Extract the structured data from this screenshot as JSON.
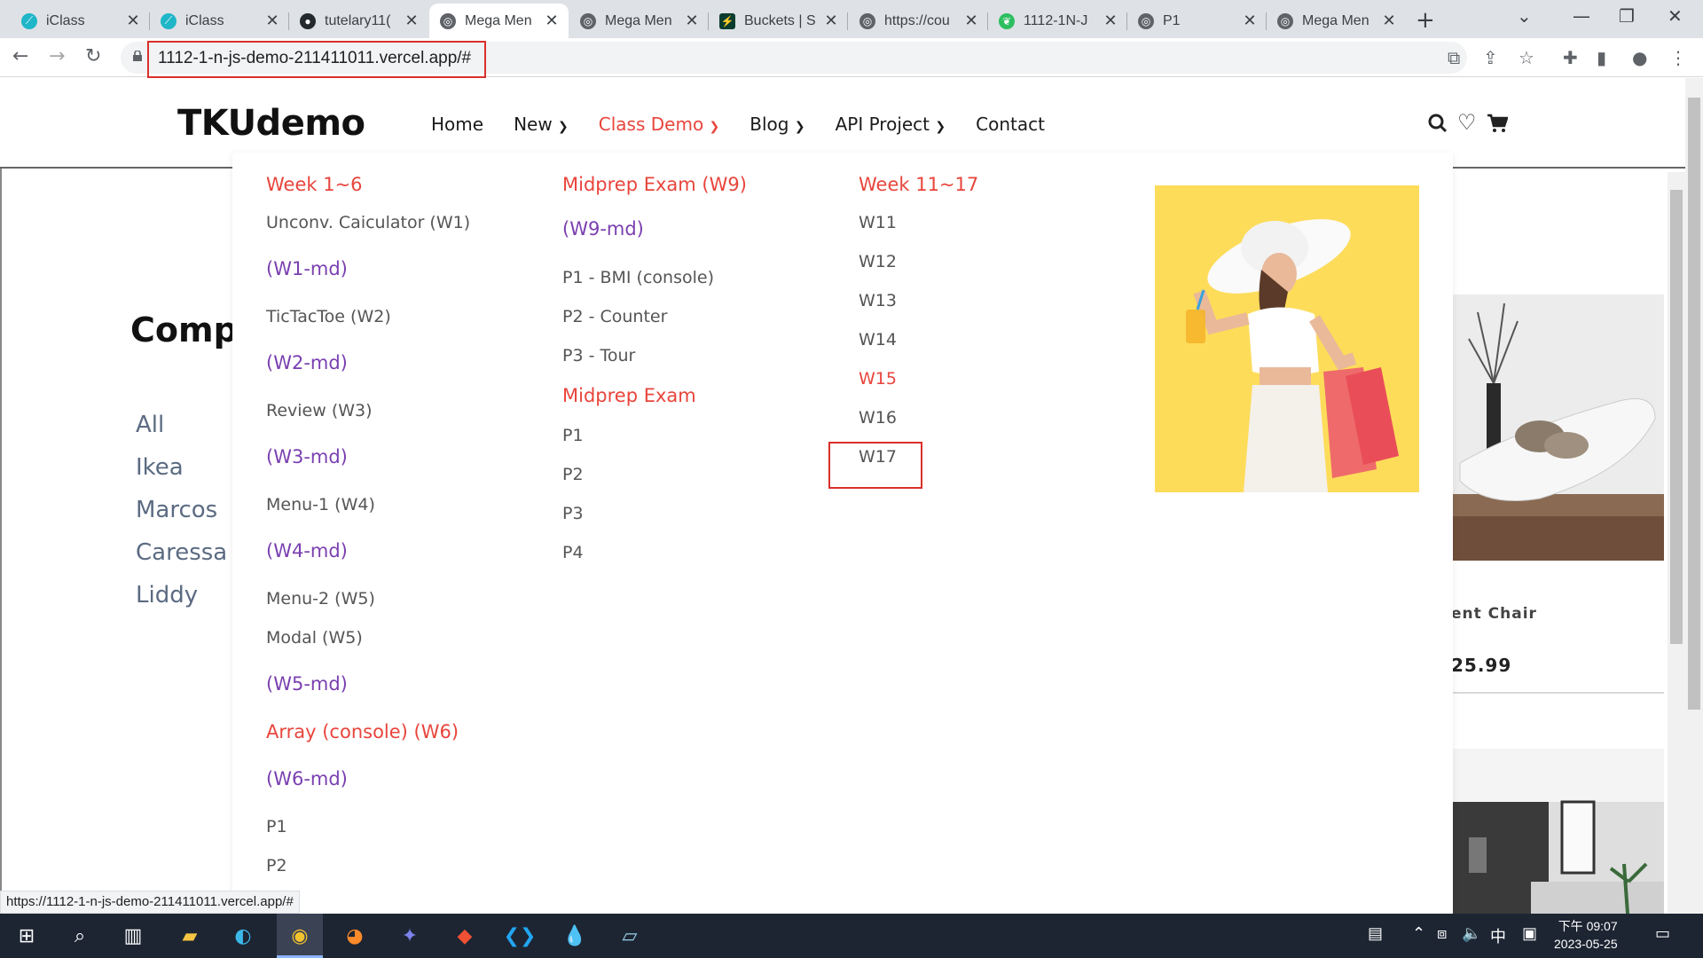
{
  "browser": {
    "tabs": [
      {
        "title": "iClass",
        "active": false
      },
      {
        "title": "iClass",
        "active": false
      },
      {
        "title": "tutelary11(",
        "active": false
      },
      {
        "title": "Mega Men",
        "active": true
      },
      {
        "title": "Mega Men",
        "active": false
      },
      {
        "title": "Buckets | S",
        "active": false
      },
      {
        "title": "https://cou",
        "active": false
      },
      {
        "title": "1112-1N-J",
        "active": false
      },
      {
        "title": "P1",
        "active": false
      },
      {
        "title": "Mega Men",
        "active": false
      }
    ],
    "url": "1112-1-n-js-demo-211411011.vercel.app/#",
    "status_url": "https://1112-1-n-js-demo-211411011.vercel.app/#"
  },
  "site": {
    "logo": "TKUdemo",
    "nav": [
      {
        "label": "Home",
        "has_caret": false,
        "active": false
      },
      {
        "label": "New",
        "has_caret": true,
        "active": false
      },
      {
        "label": "Class Demo",
        "has_caret": true,
        "active": true
      },
      {
        "label": "Blog",
        "has_caret": true,
        "active": false
      },
      {
        "label": "API Project",
        "has_caret": true,
        "active": false
      },
      {
        "label": "Contact",
        "has_caret": false,
        "active": false
      }
    ],
    "background": {
      "section_title": "Compa",
      "categories": [
        "All",
        "Ikea",
        "Marcos",
        "Caressa",
        "Liddy"
      ],
      "card_label": "ent Chair",
      "card_price": "25.99"
    }
  },
  "mega_menu": {
    "col1": [
      {
        "text": "Week 1~6",
        "kind": "head"
      },
      {
        "text": "Unconv. Caiculator (W1)",
        "kind": "link"
      },
      {
        "text": "(W1-md)",
        "kind": "md"
      },
      {
        "text": "TicTacToe (W2)",
        "kind": "link"
      },
      {
        "text": "(W2-md)",
        "kind": "md"
      },
      {
        "text": "Review (W3)",
        "kind": "link"
      },
      {
        "text": "(W3-md)",
        "kind": "md"
      },
      {
        "text": "Menu-1 (W4)",
        "kind": "link"
      },
      {
        "text": "(W4-md)",
        "kind": "md"
      },
      {
        "text": "Menu-2 (W5)",
        "kind": "link"
      },
      {
        "text": "Modal (W5)",
        "kind": "link"
      },
      {
        "text": "(W5-md)",
        "kind": "md"
      },
      {
        "text": "Array (console) (W6)",
        "kind": "head"
      },
      {
        "text": "(W6-md)",
        "kind": "md"
      },
      {
        "text": "P1",
        "kind": "link"
      },
      {
        "text": "P2",
        "kind": "link"
      }
    ],
    "col2": [
      {
        "text": "Midprep Exam (W9)",
        "kind": "head"
      },
      {
        "text": "(W9-md)",
        "kind": "md"
      },
      {
        "text": "P1 - BMI (console)",
        "kind": "link"
      },
      {
        "text": "P2 - Counter",
        "kind": "link"
      },
      {
        "text": "P3 - Tour",
        "kind": "link"
      },
      {
        "text": "Midprep Exam",
        "kind": "head"
      },
      {
        "text": "P1",
        "kind": "link"
      },
      {
        "text": "P2",
        "kind": "link"
      },
      {
        "text": "P3",
        "kind": "link"
      },
      {
        "text": "P4",
        "kind": "link"
      }
    ],
    "col3": [
      {
        "text": "Week 11~17",
        "kind": "head"
      },
      {
        "text": "W11",
        "kind": "link"
      },
      {
        "text": "W12",
        "kind": "link"
      },
      {
        "text": "W13",
        "kind": "link"
      },
      {
        "text": "W14",
        "kind": "link"
      },
      {
        "text": "W15",
        "kind": "red-link"
      },
      {
        "text": "W16",
        "kind": "link"
      },
      {
        "text": "W17",
        "kind": "link"
      }
    ]
  },
  "taskbar": {
    "clock_time": "下午 09:07",
    "clock_date": "2023-05-25",
    "ime": "中"
  },
  "colors": {
    "accent_red": "#e8453c",
    "md_purple": "#7a3fb0",
    "highlight_box": "#d9302b",
    "promo_bg": "#fddc5a"
  }
}
